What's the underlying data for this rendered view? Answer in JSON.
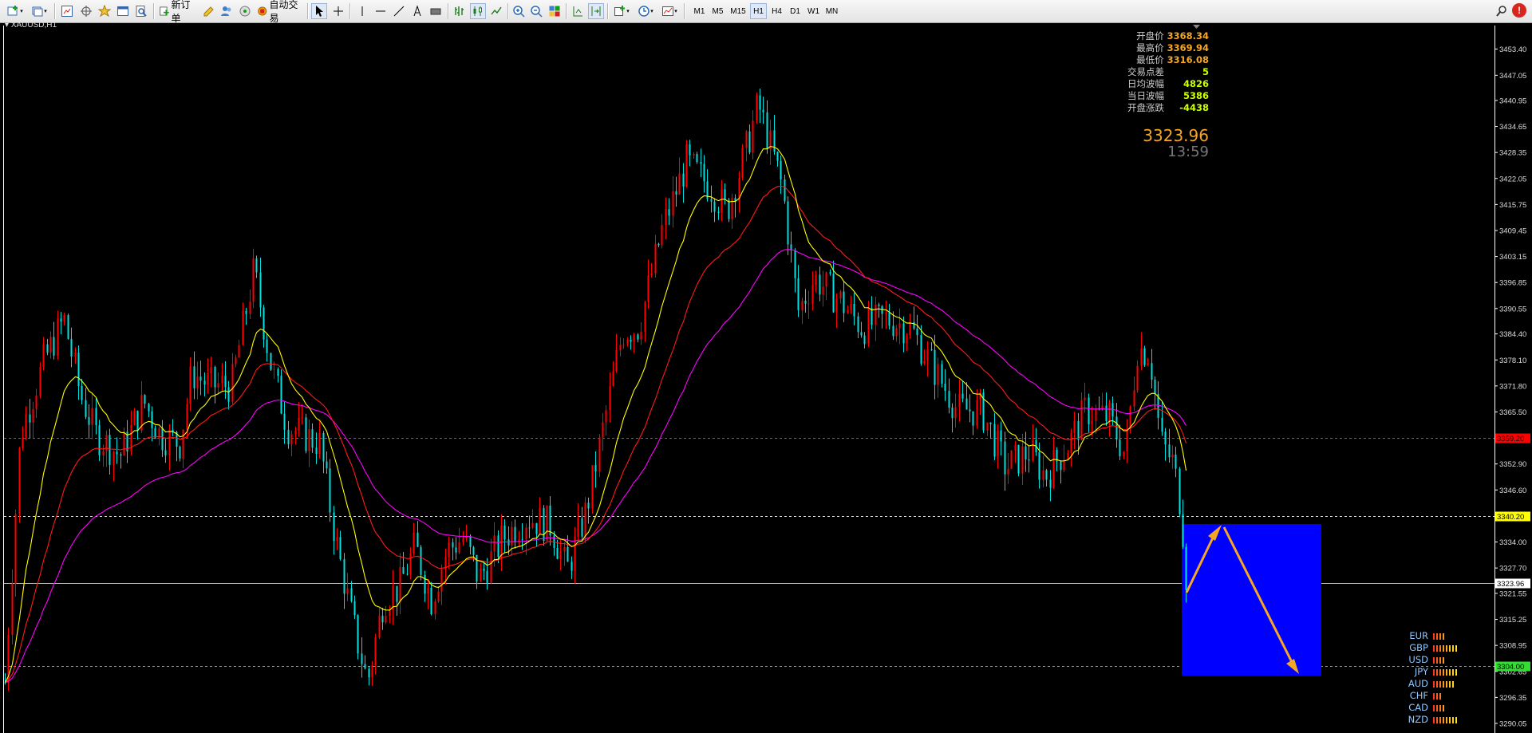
{
  "toolbar": {
    "new_order_label": "新订单",
    "auto_trade_label": "自动交易",
    "timeframes": [
      "M1",
      "M5",
      "M15",
      "H1",
      "H4",
      "D1",
      "W1",
      "MN"
    ],
    "active_timeframe": "H1",
    "alert_badge": "!"
  },
  "chart": {
    "symbol_label": "XAUUSD,H1",
    "current_price": "3323.96",
    "countdown": "13:59",
    "colors": {
      "bull": "#ff0000",
      "bear": "#00e0e0",
      "ma_fast": "#ffff00",
      "ma_mid": "#ff1a1a",
      "ma_slow": "#ff00ff",
      "box": "#0000ff",
      "arrows": "#f5a623"
    }
  },
  "stats": [
    {
      "label": "开盘价",
      "value": "3368.34",
      "color": "#f5a623"
    },
    {
      "label": "最高价",
      "value": "3369.94",
      "color": "#f5a623"
    },
    {
      "label": "最低价",
      "value": "3316.08",
      "color": "#f5a623"
    },
    {
      "label": "交易点差",
      "value": "5",
      "color": "#ccff00"
    },
    {
      "label": "日均波幅",
      "value": "4826",
      "color": "#ccff00"
    },
    {
      "label": "当日波幅",
      "value": "5386",
      "color": "#ccff00"
    },
    {
      "label": "开盘涨跌",
      "value": "-4438",
      "color": "#ccff00"
    }
  ],
  "price_scale": [
    "3453.40",
    "3447.05",
    "3440.95",
    "3434.65",
    "3428.35",
    "3422.05",
    "3415.75",
    "3409.45",
    "3403.15",
    "3396.85",
    "3390.55",
    "3384.40",
    "3378.10",
    "3371.80",
    "3365.50",
    "3359.20",
    "3352.90",
    "3346.60",
    "3340.20",
    "3334.00",
    "3327.70",
    "3321.55",
    "3315.25",
    "3308.95",
    "3302.65",
    "3296.35",
    "3290.05"
  ],
  "levels": [
    {
      "name": "red-level",
      "price": "3359.20",
      "color": "#ff2a2a",
      "tag_bg": "#ff0000",
      "tag_fg": "#111"
    },
    {
      "name": "yellow-level",
      "price": "3340.20",
      "color": "#ffff00",
      "tag_bg": "#ffff00",
      "tag_fg": "#000"
    },
    {
      "name": "bid-level",
      "price": "3323.96",
      "color": "#b8b8b8",
      "tag_bg": "#ffffff",
      "tag_fg": "#000"
    },
    {
      "name": "green-level",
      "price": "3304.00",
      "color": "#33dd33",
      "tag_bg": "#33dd33",
      "tag_fg": "#000"
    }
  ],
  "currency_strength": [
    {
      "code": "EUR",
      "bars": 4
    },
    {
      "code": "GBP",
      "bars": 8
    },
    {
      "code": "USD",
      "bars": 4
    },
    {
      "code": "JPY",
      "bars": 8
    },
    {
      "code": "AUD",
      "bars": 7
    },
    {
      "code": "CHF",
      "bars": 3
    },
    {
      "code": "CAD",
      "bars": 4
    },
    {
      "code": "NZD",
      "bars": 8
    }
  ]
}
